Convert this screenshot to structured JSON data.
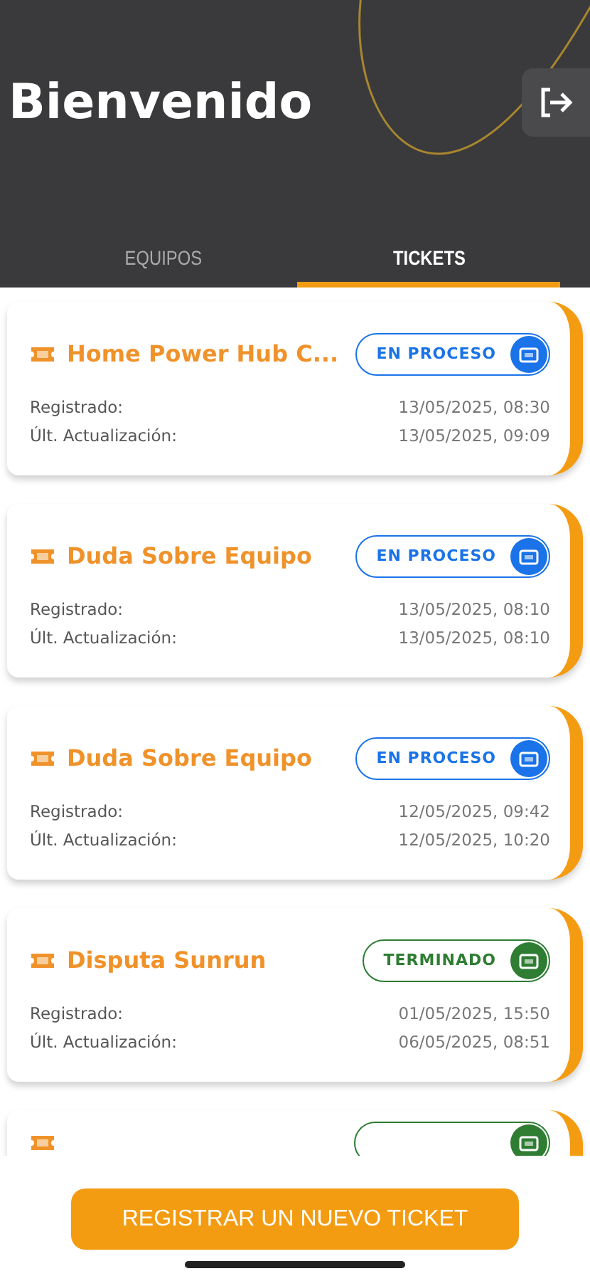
{
  "header": {
    "title": "Bienvenido"
  },
  "tabs": [
    {
      "label": "EQUIPOS",
      "selected": false
    },
    {
      "label": "TICKETS",
      "selected": true
    }
  ],
  "tickets": [
    {
      "title": "Home Power Hub C...",
      "status": {
        "label": "EN PROCESO",
        "kind": "in_progress"
      },
      "registered_label": "Registrado:",
      "registered": "13/05/2025, 08:30",
      "updated_label": "Últ. Actualización:",
      "updated": "13/05/2025, 09:09"
    },
    {
      "title": "Duda Sobre Equipo",
      "status": {
        "label": "EN PROCESO",
        "kind": "in_progress"
      },
      "registered_label": "Registrado:",
      "registered": "13/05/2025, 08:10",
      "updated_label": "Últ. Actualización:",
      "updated": "13/05/2025, 08:10"
    },
    {
      "title": "Duda Sobre Equipo",
      "status": {
        "label": "EN PROCESO",
        "kind": "in_progress"
      },
      "registered_label": "Registrado:",
      "registered": "12/05/2025, 09:42",
      "updated_label": "Últ. Actualización:",
      "updated": "12/05/2025, 10:20"
    },
    {
      "title": "Disputa Sunrun",
      "status": {
        "label": "TERMINADO",
        "kind": "done"
      },
      "registered_label": "Registrado:",
      "registered": "01/05/2025, 15:50",
      "updated_label": "Últ. Actualización:",
      "updated": "06/05/2025, 08:51"
    },
    {
      "status": {
        "kind": "done"
      }
    }
  ],
  "action_button": "REGISTRAR UN NUEVO TICKET"
}
